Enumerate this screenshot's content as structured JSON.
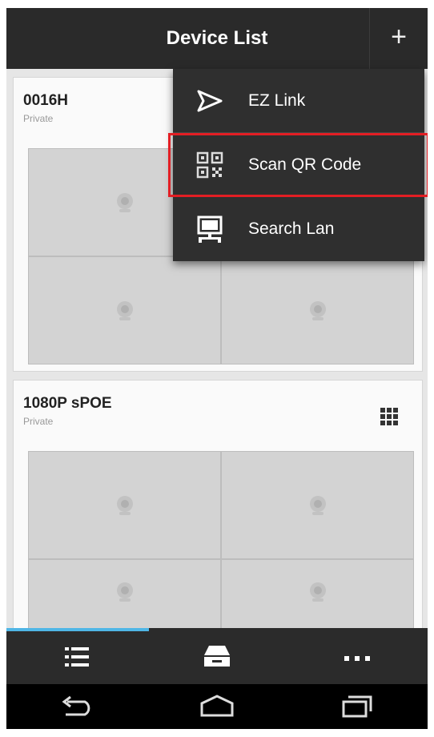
{
  "header": {
    "title": "Device List",
    "add_label": "+"
  },
  "devices": [
    {
      "name": "0016H",
      "subtitle": "Private"
    },
    {
      "name": "1080P sPOE",
      "subtitle": "Private"
    }
  ],
  "menu": {
    "items": [
      {
        "label": "EZ Link",
        "icon": "send-arrow-icon"
      },
      {
        "label": "Scan QR Code",
        "icon": "qr-code-icon"
      },
      {
        "label": "Search Lan",
        "icon": "monitor-lan-icon"
      }
    ],
    "highlight_color": "#e31e24"
  },
  "tabs": [
    {
      "icon": "list-icon",
      "selected": true
    },
    {
      "icon": "tray-icon",
      "selected": false
    },
    {
      "icon": "more-icon",
      "selected": false
    }
  ],
  "system_nav": [
    "back-icon",
    "home-icon",
    "recents-icon"
  ],
  "colors": {
    "accent": "#4fb6e6",
    "topbar": "#2a2a2a",
    "menu": "#2f2f2f"
  }
}
